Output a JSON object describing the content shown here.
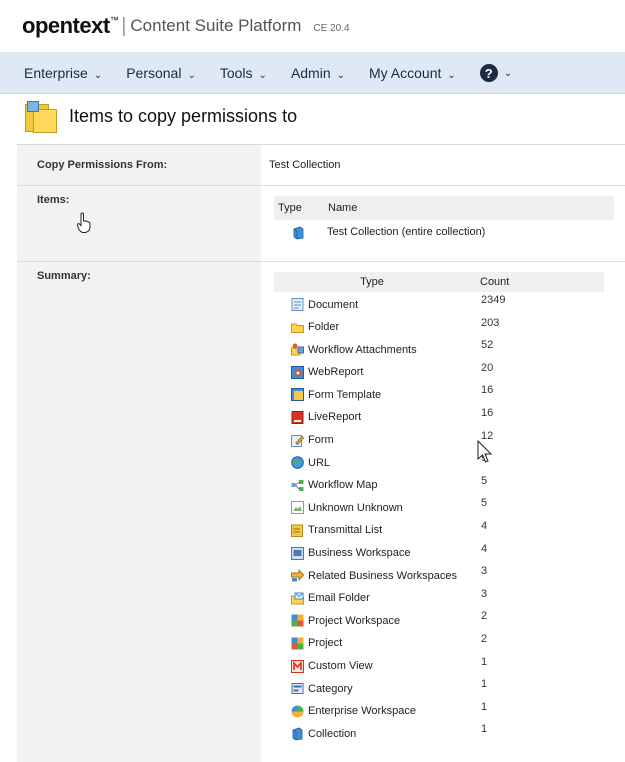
{
  "header": {
    "brand": "opentext",
    "brand_tm": "™",
    "separator": "|",
    "platform": "Content Suite Platform",
    "version": "CE 20.4"
  },
  "nav": {
    "items": [
      {
        "label": "Enterprise",
        "chevron": "⌄"
      },
      {
        "label": "Personal",
        "chevron": "⌄"
      },
      {
        "label": "Tools",
        "chevron": "⌄"
      },
      {
        "label": "Admin",
        "chevron": "⌄"
      },
      {
        "label": "My Account",
        "chevron": "⌄"
      }
    ],
    "help": {
      "glyph": "?",
      "chevron": "⌄"
    }
  },
  "page": {
    "title": "Items to copy permissions to"
  },
  "form": {
    "copy_from_label": "Copy Permissions From:",
    "copy_from_value": "Test Collection",
    "items_label": "Items:",
    "summary_label": "Summary:"
  },
  "items_table": {
    "headers": {
      "type": "Type",
      "name": "Name"
    },
    "rows": [
      {
        "icon": "collection-icon",
        "name": "Test Collection (entire collection)"
      }
    ]
  },
  "summary_table": {
    "headers": {
      "type": "Type",
      "count": "Count"
    },
    "rows": [
      {
        "type": "Document",
        "count": "2349",
        "icon": "document-icon"
      },
      {
        "type": "Folder",
        "count": "203",
        "icon": "folder-icon"
      },
      {
        "type": "Workflow Attachments",
        "count": "52",
        "icon": "workflow-attachments-icon"
      },
      {
        "type": "WebReport",
        "count": "20",
        "icon": "webreport-icon"
      },
      {
        "type": "Form Template",
        "count": "16",
        "icon": "form-template-icon"
      },
      {
        "type": "LiveReport",
        "count": "16",
        "icon": "livereport-icon"
      },
      {
        "type": "Form",
        "count": "12",
        "icon": "form-icon"
      },
      {
        "type": "URL",
        "count": "9",
        "icon": "url-icon"
      },
      {
        "type": "Workflow Map",
        "count": "5",
        "icon": "workflow-map-icon"
      },
      {
        "type": "Unknown Unknown",
        "count": "5",
        "icon": "broken-image-icon"
      },
      {
        "type": "Transmittal List",
        "count": "4",
        "icon": "transmittal-list-icon"
      },
      {
        "type": "Business Workspace",
        "count": "4",
        "icon": "business-workspace-icon"
      },
      {
        "type": "Related Business Workspaces",
        "count": "3",
        "icon": "related-workspaces-icon"
      },
      {
        "type": "Email Folder",
        "count": "3",
        "icon": "email-folder-icon"
      },
      {
        "type": "Project Workspace",
        "count": "2",
        "icon": "project-workspace-icon"
      },
      {
        "type": "Project",
        "count": "2",
        "icon": "project-icon"
      },
      {
        "type": "Custom View",
        "count": "1",
        "icon": "custom-view-icon"
      },
      {
        "type": "Category",
        "count": "1",
        "icon": "category-icon"
      },
      {
        "type": "Enterprise Workspace",
        "count": "1",
        "icon": "enterprise-workspace-icon"
      },
      {
        "type": "Collection",
        "count": "1",
        "icon": "collection-icon"
      }
    ]
  },
  "colors": {
    "nav_bg": "#dfe9f6",
    "label_bg": "#f2f2f2",
    "header_bg": "#f0f0f0",
    "text": "#222222"
  }
}
